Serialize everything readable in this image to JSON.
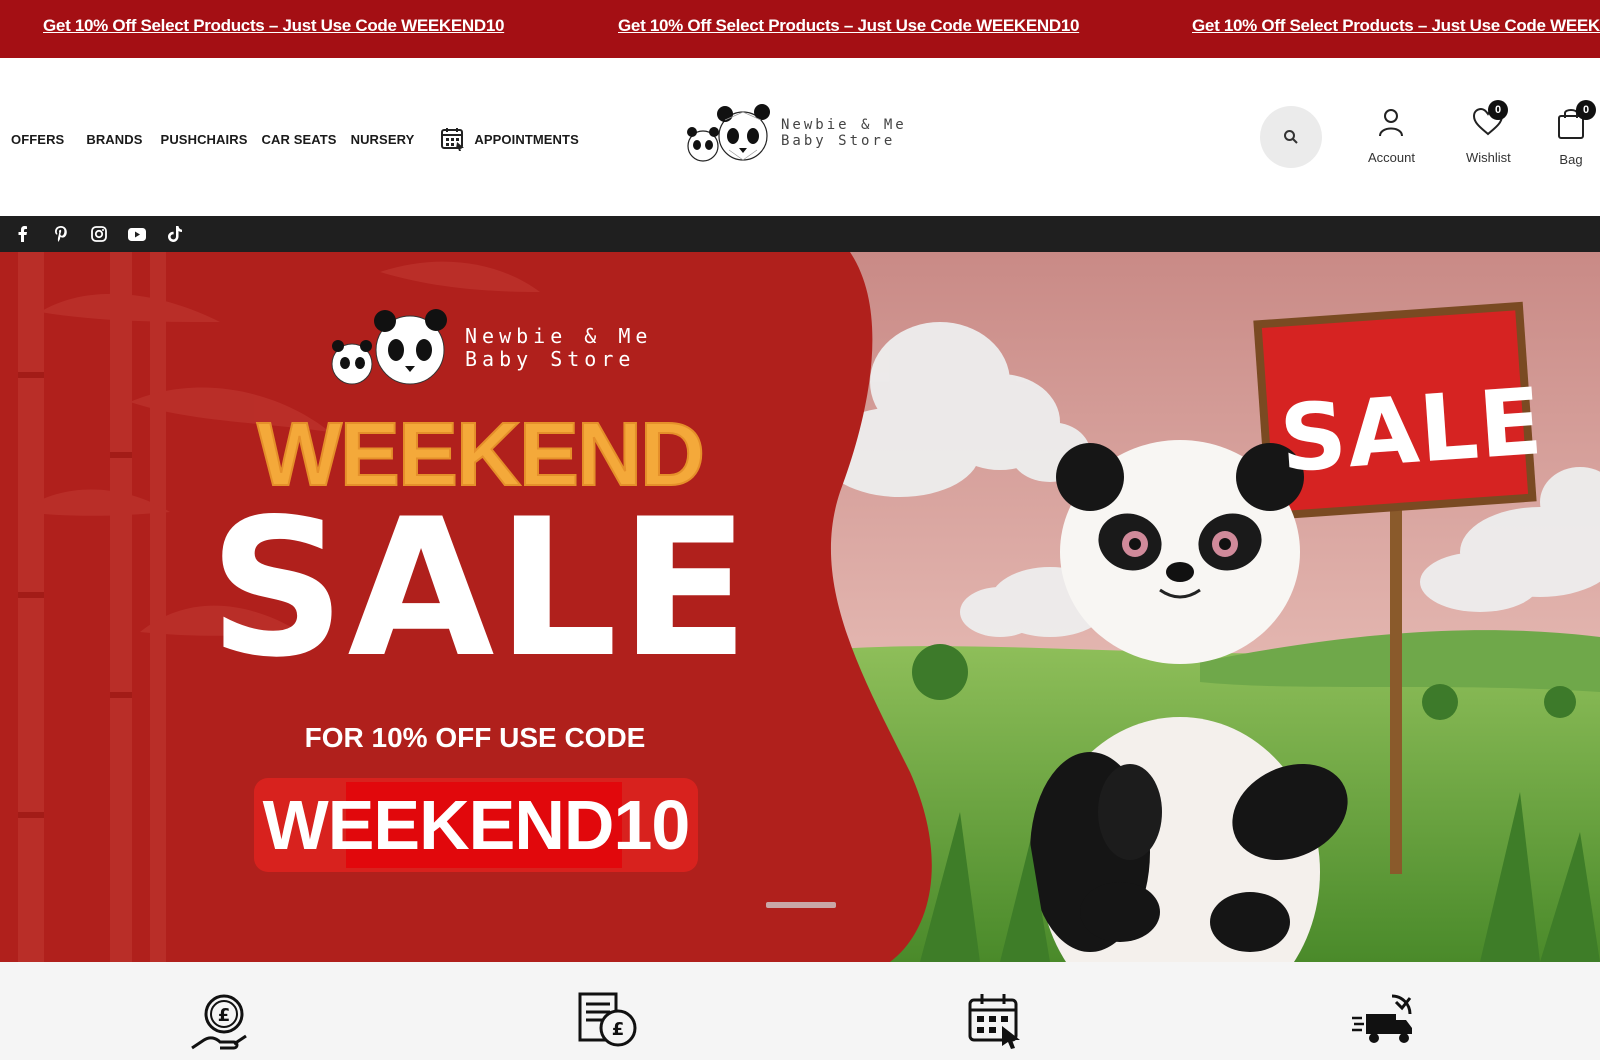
{
  "announcement": {
    "messages": [
      "Get 10% Off Select Products – Just Use Code WEEKEND10",
      "Get 10% Off Select Products – Just Use Code WEEKEND10",
      "Get 10% Off Select Products – Just Use Code WEEKEND10"
    ]
  },
  "nav": {
    "items": [
      "OFFERS",
      "BRANDS",
      "PUSHCHAIRS",
      "CAR SEATS",
      "NURSERY"
    ],
    "appointments": "APPOINTMENTS"
  },
  "logo": {
    "line1": "Newbie & Me",
    "line2": "Baby Store"
  },
  "header_actions": {
    "account": "Account",
    "wishlist": "Wishlist",
    "wishlist_count": "0",
    "bag": "Bag",
    "bag_count": "0"
  },
  "social": [
    "facebook-icon",
    "pinterest-icon",
    "instagram-icon",
    "youtube-icon",
    "tiktok-icon"
  ],
  "hero": {
    "logo_line1": "Newbie & Me",
    "logo_line2": "Baby Store",
    "weekend": "WEEKEND",
    "sale": "SALE",
    "use_code": "FOR 10% OFF USE CODE",
    "code": "WEEKEND10",
    "sign": "SALE"
  },
  "colors": {
    "announce_bg": "#a40f14",
    "hero_red": "#b0201c",
    "accent_orange": "#f4a93a"
  }
}
